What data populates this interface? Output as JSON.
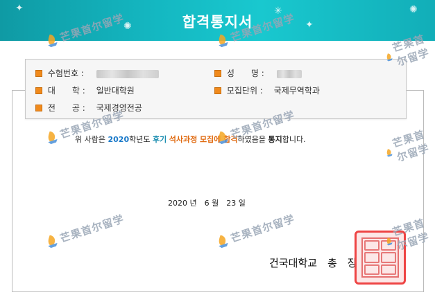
{
  "header": {
    "title": "합격통지서"
  },
  "info": {
    "exam_no_label": "수험번호 :",
    "name_label": "성　　명 :",
    "college_label": "대　　학 :",
    "college_value": "일반대학원",
    "unit_label": "모집단위 :",
    "unit_value": "국제무역학과",
    "major_label": "전　　공 :",
    "major_value": "국제경영전공"
  },
  "notice": {
    "prefix": "위 사람은 ",
    "year": "2020",
    "mid": "학년도 ",
    "term": "후기",
    "space": " ",
    "program": "석사과정 모집에 합격",
    "mid2": "하였음을 ",
    "notify": "통지",
    "suffix": "합니다."
  },
  "date": {
    "text": "2020 년　6 월　23 일"
  },
  "signature": {
    "text": "건국대학교　총　장"
  },
  "watermark": {
    "text": "芒果首尔留学"
  }
}
